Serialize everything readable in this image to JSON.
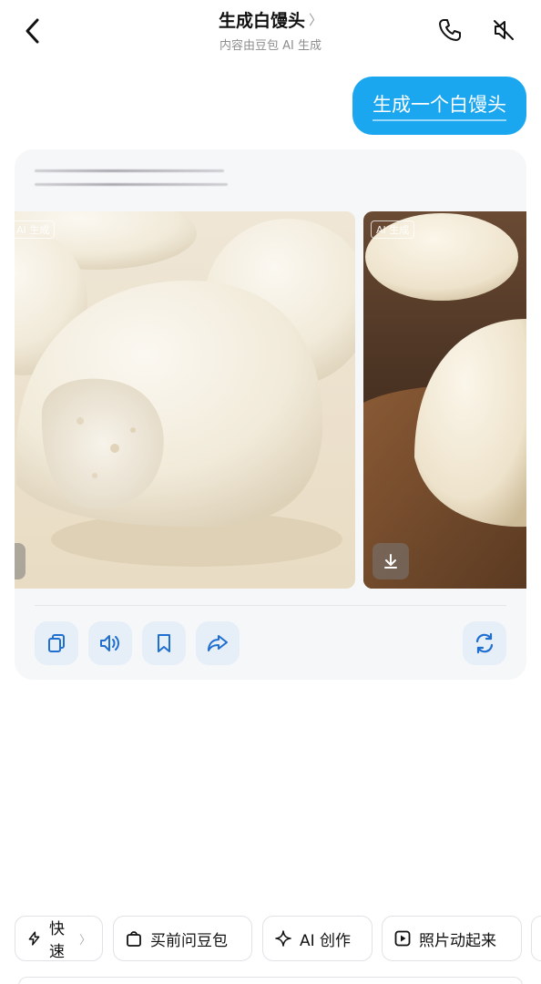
{
  "header": {
    "title": "生成白馒头",
    "title_chevron": "〉",
    "subtitle": "内容由豆包 AI 生成"
  },
  "chat": {
    "user_message": "生成一个白馒头"
  },
  "response": {
    "images": [
      {
        "badge": "AI 生成"
      },
      {
        "badge": "AI 生成"
      }
    ]
  },
  "chips": [
    {
      "label": "快速",
      "chevron": "〉",
      "icon": "lightning-icon"
    },
    {
      "label": "买前问豆包",
      "icon": "shopping-bag-icon"
    },
    {
      "label": "AI 创作",
      "icon": "sparkle-icon"
    },
    {
      "label": "照片动起来",
      "icon": "play-square-icon"
    }
  ],
  "colors": {
    "bubble": "#1aa7f0",
    "action_bg": "#e6eef8",
    "action_icon": "#1f6fd1",
    "card_bg": "#f6f7f9"
  }
}
